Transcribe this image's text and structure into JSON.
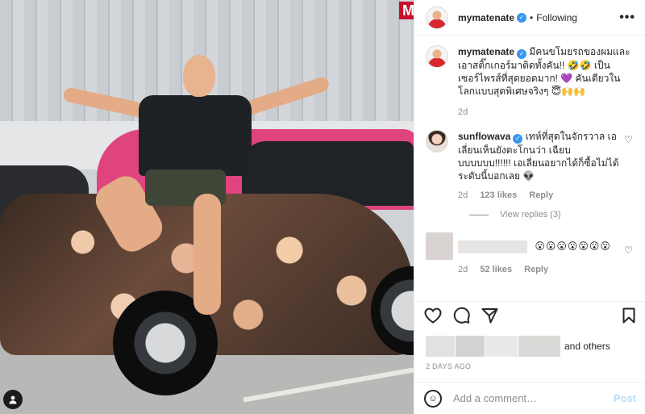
{
  "post": {
    "photo_sign": "M",
    "author": "mymatenate",
    "separator": "•",
    "follow_status": "Following",
    "more_label": "•••"
  },
  "caption": {
    "username": "mymatenate",
    "text": "มีคนขโมยรถของผมและเอาสติ๊กเกอร์มาติดทั้งคัน!! 🤣🤣 เป็นเซอร์ไพรส์ที่สุดยอดมาก! 💜 คันเดียวในโลกแบบสุดพิเศษจริงๆ 😇🙌🙌",
    "time": "2d"
  },
  "comments": [
    {
      "username": "sunflowava",
      "text": "เทห์ที่สุดในจักรวาล เอเลี่ยนเห็นยังตะโกนว่า เฉียบบบบบบบ!!!!!! เอเลี่ยนอยากได้ก็ซื้อไม่ได้ระดับนี้บอกเลย 👽",
      "time": "2d",
      "likes": "123 likes",
      "reply": "Reply",
      "view_replies": "View replies (3)"
    },
    {
      "username": "",
      "text": "😮😮😮😮😮😮😮",
      "time": "2d",
      "likes": "52 likes",
      "reply": "Reply"
    }
  ],
  "likes_text": "and others",
  "posted_ago": "2 DAYS AGO",
  "add_comment": {
    "placeholder": "Add a comment…",
    "post_label": "Post"
  },
  "icons": {
    "verified": "✓",
    "heart": "♡",
    "comment": "◯",
    "share": "➤",
    "bookmark": "▯",
    "smile": "☺",
    "tag": "👤"
  },
  "colors": {
    "verified_blue": "#3897f0",
    "post_blue": "#b2dffc",
    "text": "#262626",
    "muted": "#8e8e8e"
  }
}
